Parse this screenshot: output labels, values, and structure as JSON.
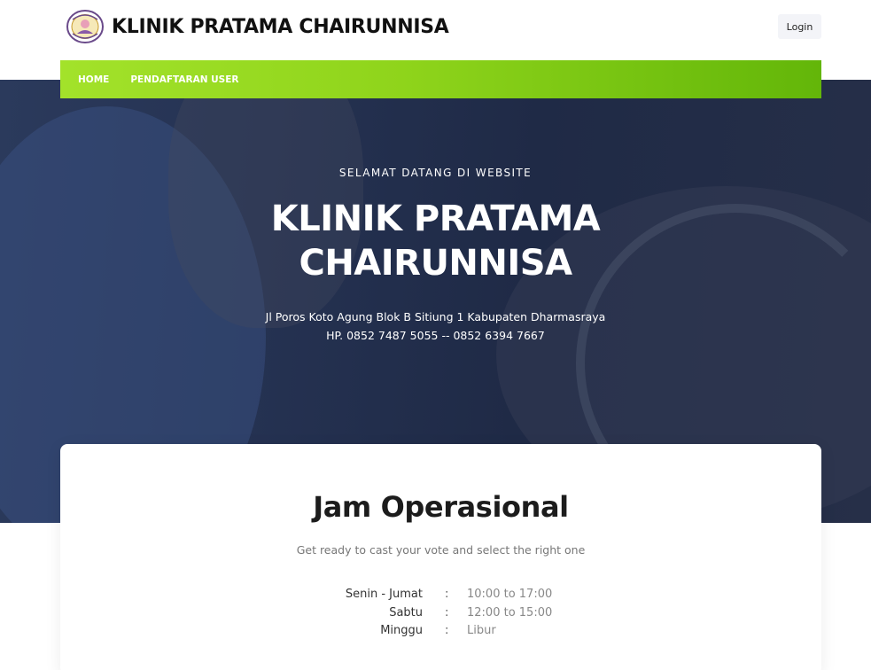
{
  "header": {
    "brand_name": "KLINIK PRATAMA CHAIRUNNISA",
    "login_label": "Login"
  },
  "nav": {
    "items": [
      {
        "label": "HOME"
      },
      {
        "label": "PENDAFTARAN USER"
      }
    ]
  },
  "hero": {
    "welcome": "SELAMAT DATANG DI WEBSITE",
    "title_line1": "KLINIK PRATAMA",
    "title_line2": "CHAIRUNNISA",
    "address": "Jl Poros Koto Agung Blok B Sitiung 1 Kabupaten Dharmasraya",
    "phone": "HP. 0852 7487 5055 -- 0852 6394 7667"
  },
  "hours": {
    "title": "Jam Operasional",
    "subtitle": "Get ready to cast your vote and select the right one",
    "separator": ":",
    "rows": [
      {
        "day": "Senin - Jumat",
        "time": "10:00 to 17:00"
      },
      {
        "day": "Sabtu",
        "time": "12:00 to 15:00"
      },
      {
        "day": "Minggu",
        "time": "Libur"
      }
    ]
  },
  "colors": {
    "nav_green_start": "#a3e22a",
    "nav_green_end": "#63b609",
    "hero_navy": "#1f2a46"
  }
}
